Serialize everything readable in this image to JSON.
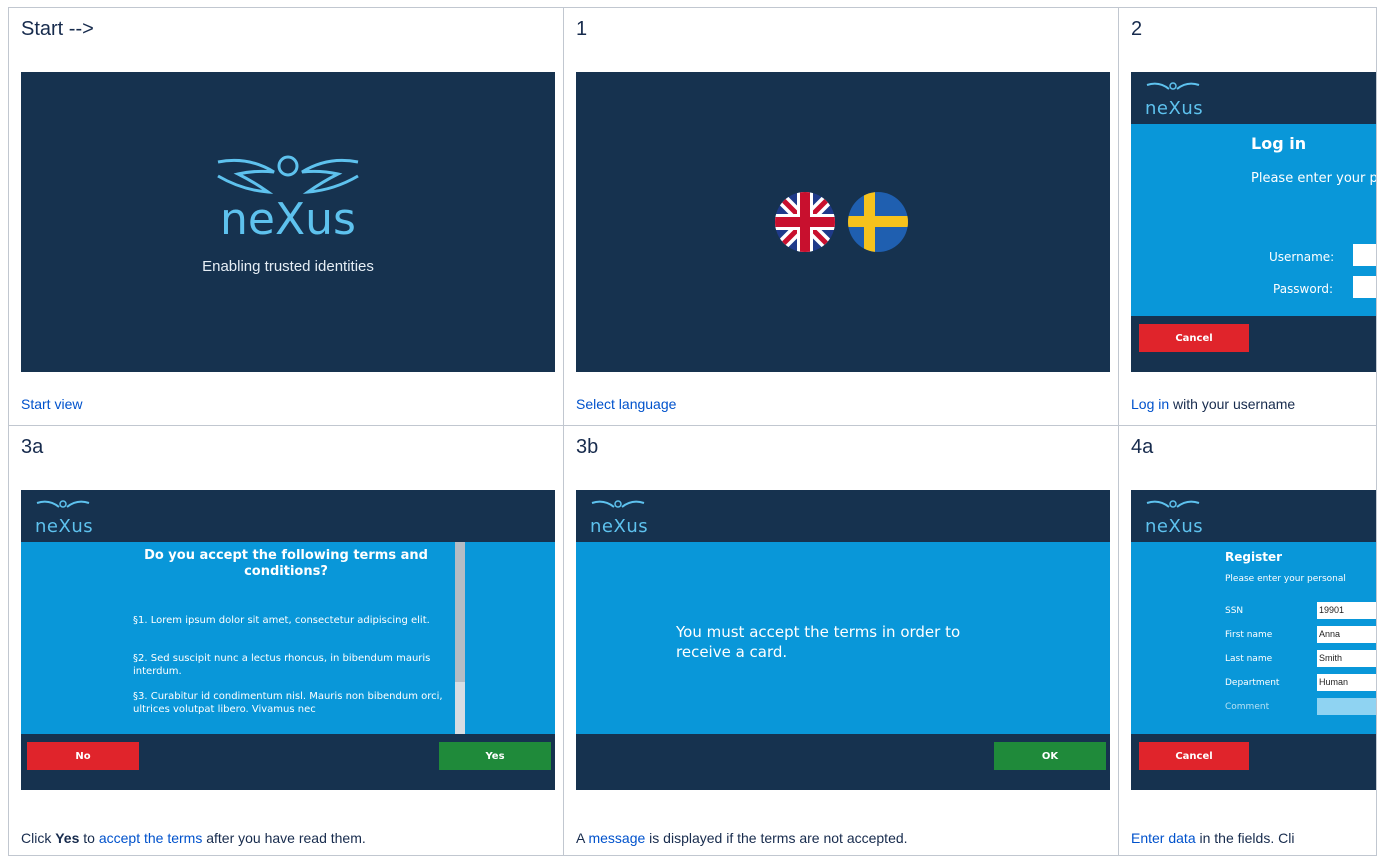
{
  "cells": {
    "start": {
      "title": "Start -->",
      "brand": "neXus",
      "tagline": "Enabling trusted identities",
      "caption_link": "Start view"
    },
    "one": {
      "title": "1",
      "caption_link": "Select language"
    },
    "two": {
      "title": "2",
      "heading": "Log in",
      "intro": "Please enter your password.",
      "username_label": "Username:",
      "password_label": "Password:",
      "cancel": "Cancel",
      "caption_link": "Log in",
      "caption_rest": " with your username"
    },
    "three_a": {
      "title": "3a",
      "heading": "Do you accept the following terms and conditions?",
      "p1": "§1. Lorem ipsum dolor sit amet, consectetur adipiscing elit.",
      "p2": "§2. Sed suscipit nunc a lectus rhoncus, in bibendum mauris interdum.",
      "p3": "§3. Curabitur id condimentum nisl. Mauris non bibendum orci, ultrices volutpat libero. Vivamus nec",
      "no": "No",
      "yes": "Yes",
      "caption_pre": "Click ",
      "caption_bold": "Yes",
      "caption_mid": " to ",
      "caption_link": "accept the terms",
      "caption_rest": " after you have read them."
    },
    "three_b": {
      "title": "3b",
      "message": "You must accept the terms in order to receive a card.",
      "ok": "OK",
      "caption_pre": "A ",
      "caption_link": "message",
      "caption_rest": " is displayed if the terms are not accepted."
    },
    "four_a": {
      "title": "4a",
      "heading": "Register",
      "intro": "Please enter your personal",
      "fields": [
        {
          "label": "SSN",
          "value": "19901"
        },
        {
          "label": "First name",
          "value": "Anna"
        },
        {
          "label": "Last name",
          "value": "Smith"
        },
        {
          "label": "Department",
          "value": "Human"
        },
        {
          "label": "Comment",
          "value": ""
        }
      ],
      "cancel": "Cancel",
      "caption_link": "Enter data",
      "caption_rest": " in the fields. Cli"
    }
  },
  "colors": {
    "navy": "#16324f",
    "blue": "#0997d9",
    "red": "#e0242b",
    "green": "#1f8a3a",
    "link": "#0052cc"
  }
}
